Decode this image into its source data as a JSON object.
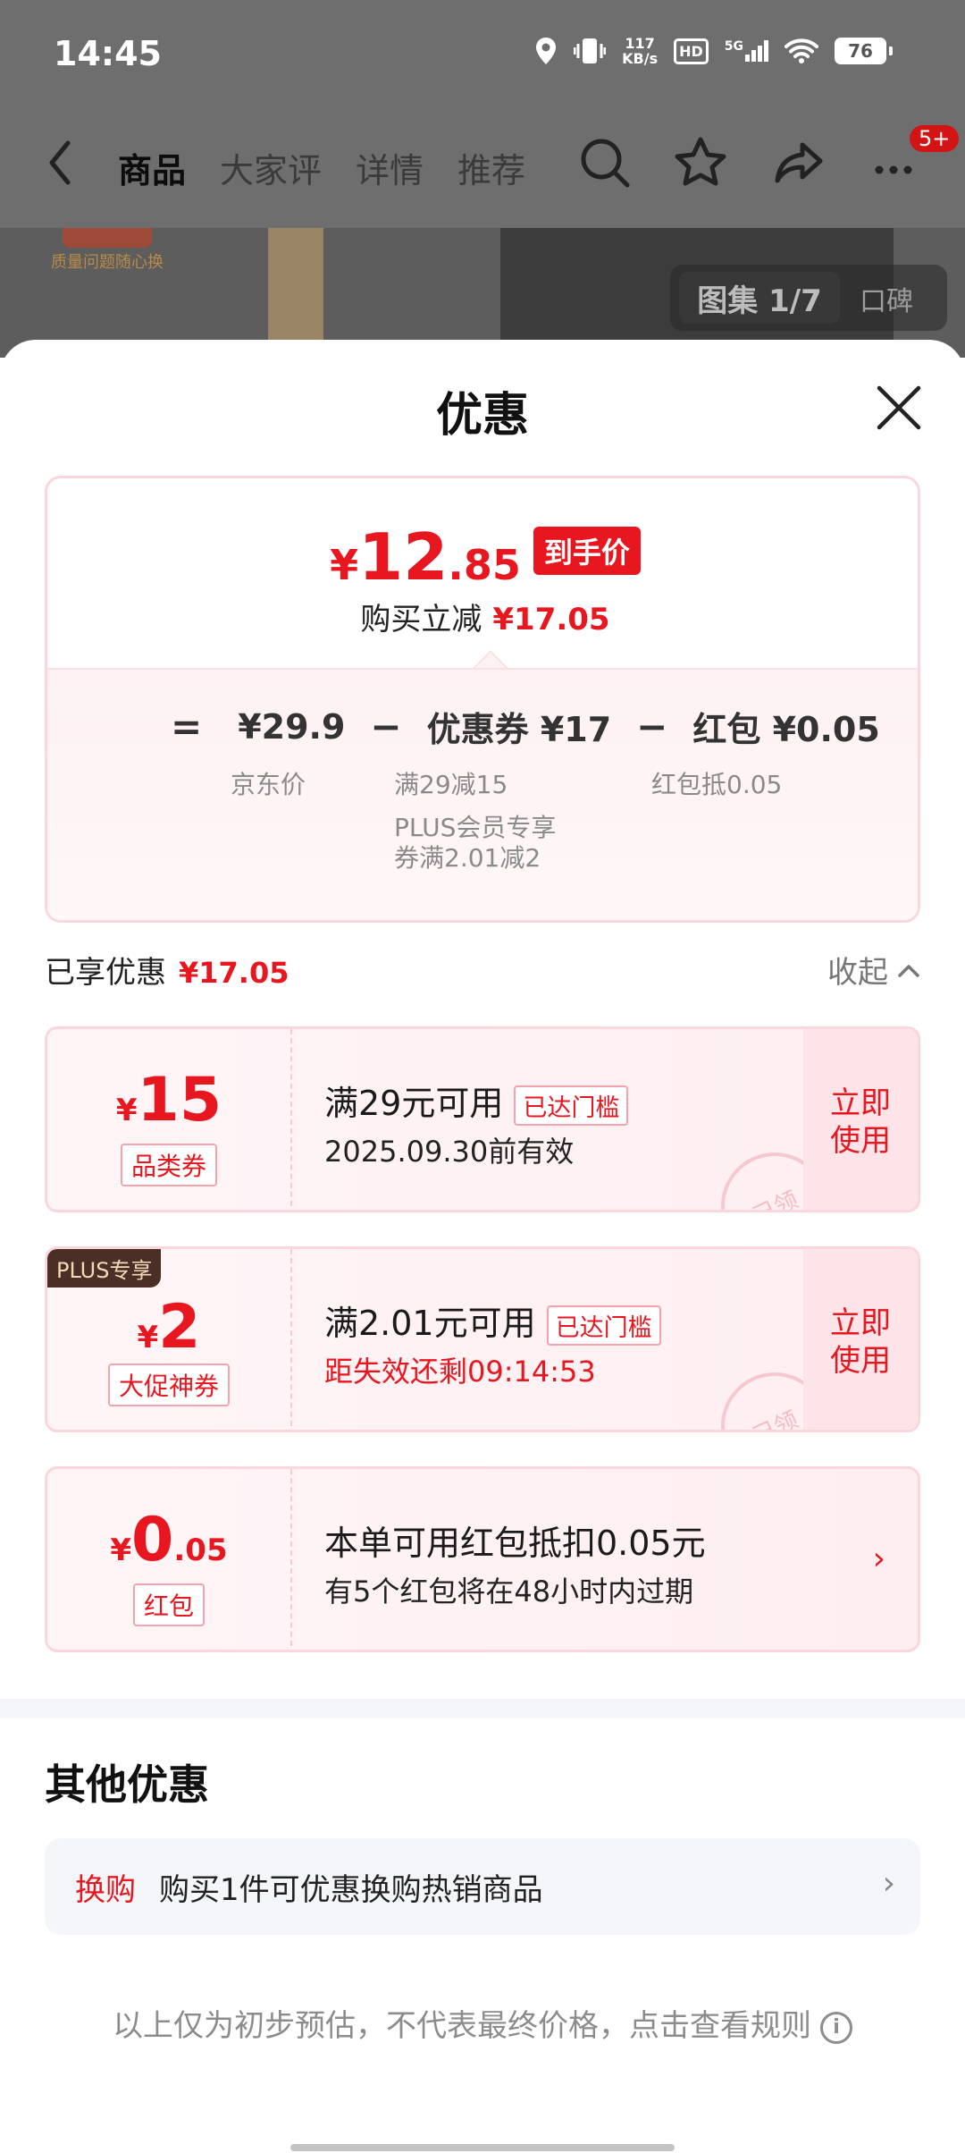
{
  "status": {
    "time": "14:45",
    "speed_value": "117",
    "speed_unit": "KB/s",
    "hd": "HD",
    "network": "5G",
    "battery": "76"
  },
  "nav": {
    "tabs": [
      "商品",
      "大家评",
      "详情",
      "推荐"
    ],
    "badge": "5+"
  },
  "background": {
    "gallery": "图集 1/7",
    "reviews": "口碑"
  },
  "sheet": {
    "title": "优惠",
    "summary": {
      "currency": "¥",
      "final_int": "12",
      "final_dec": ".85",
      "final_tag": "到手价",
      "reduce_label": "购买立减",
      "reduce_amount": "¥17.05",
      "equals": "=",
      "minus": "−",
      "jd_price": "¥29.9",
      "jd_price_label": "京东价",
      "coupon_total": "优惠券 ¥17",
      "coupon_detail_1": "满29减15",
      "coupon_detail_2": "PLUS会员专享券满2.01减2",
      "redpacket_total": "红包 ¥0.05",
      "redpacket_detail": "红包抵0.05"
    },
    "enjoyed": {
      "label": "已享优惠",
      "amount": "¥17.05",
      "collapse": "收起"
    },
    "coupons": [
      {
        "currency": "¥",
        "amount": "15",
        "type": "品类券",
        "condition": "满29元可用",
        "reach": "已达门槛",
        "validity": "2025.09.30前有效",
        "action": "立即使用",
        "stamp": "已领"
      },
      {
        "plus": "PLUS专享",
        "currency": "¥",
        "amount": "2",
        "type": "大促神券",
        "condition": "满2.01元可用",
        "reach": "已达门槛",
        "validity": "距失效还剩09:14:53",
        "action": "立即使用",
        "stamp": "已领"
      },
      {
        "currency": "¥",
        "amount": "0",
        "amount_dec": ".05",
        "type": "红包",
        "condition": "本单可用红包抵扣0.05元",
        "validity": "有5个红包将在48小时内过期"
      }
    ],
    "other": {
      "title": "其他优惠",
      "tag": "换购",
      "text": "购买1件可优惠换购热销商品"
    },
    "disclaimer": "以上仅为初步预估，不代表最终价格，点击查看规则"
  }
}
